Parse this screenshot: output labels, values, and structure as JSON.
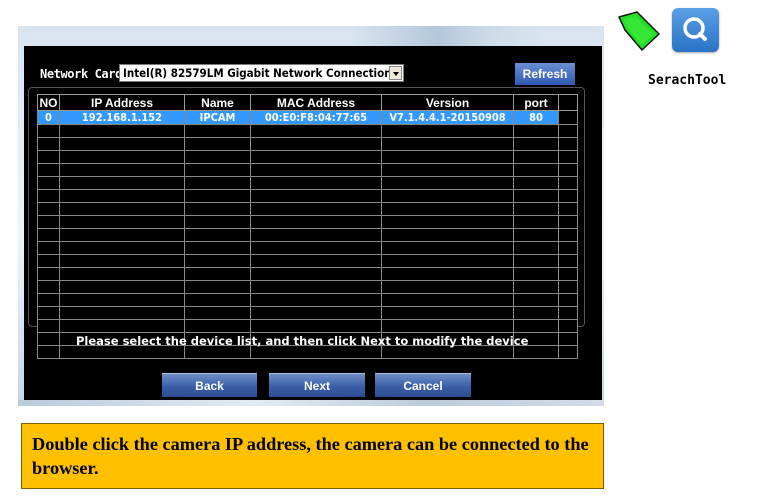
{
  "network_card": {
    "label": "Network Card",
    "selected": "Intel(R) 82579LM Gigabit Network Connection",
    "refresh_label": "Refresh"
  },
  "device_list": {
    "columns": [
      "NO",
      "IP Address",
      "Name",
      "MAC Address",
      "Version",
      "port"
    ],
    "rows": [
      [
        "0",
        "192.168.1.152",
        "IPCAM",
        "00:E0:F8:04:77:65",
        "V7.1.4.4.1-20150908",
        "80"
      ]
    ],
    "empty_rows": 18,
    "selected_row": 0
  },
  "hint": "Please select the device list, and then click Next to modify the device",
  "buttons": {
    "back": "Back",
    "next": "Next",
    "cancel": "Cancel"
  },
  "note": "Double click the camera IP address, the camera can be connected to the browser.",
  "search_tool": {
    "label": "SerachTool",
    "icon": "magnifier-icon",
    "pointer_icon": "green-arrow-icon"
  },
  "colors": {
    "selection": "#3399ff",
    "button": "#3a5fa7",
    "note_bg": "#ffc000",
    "arrow_green": "#22dd22"
  }
}
